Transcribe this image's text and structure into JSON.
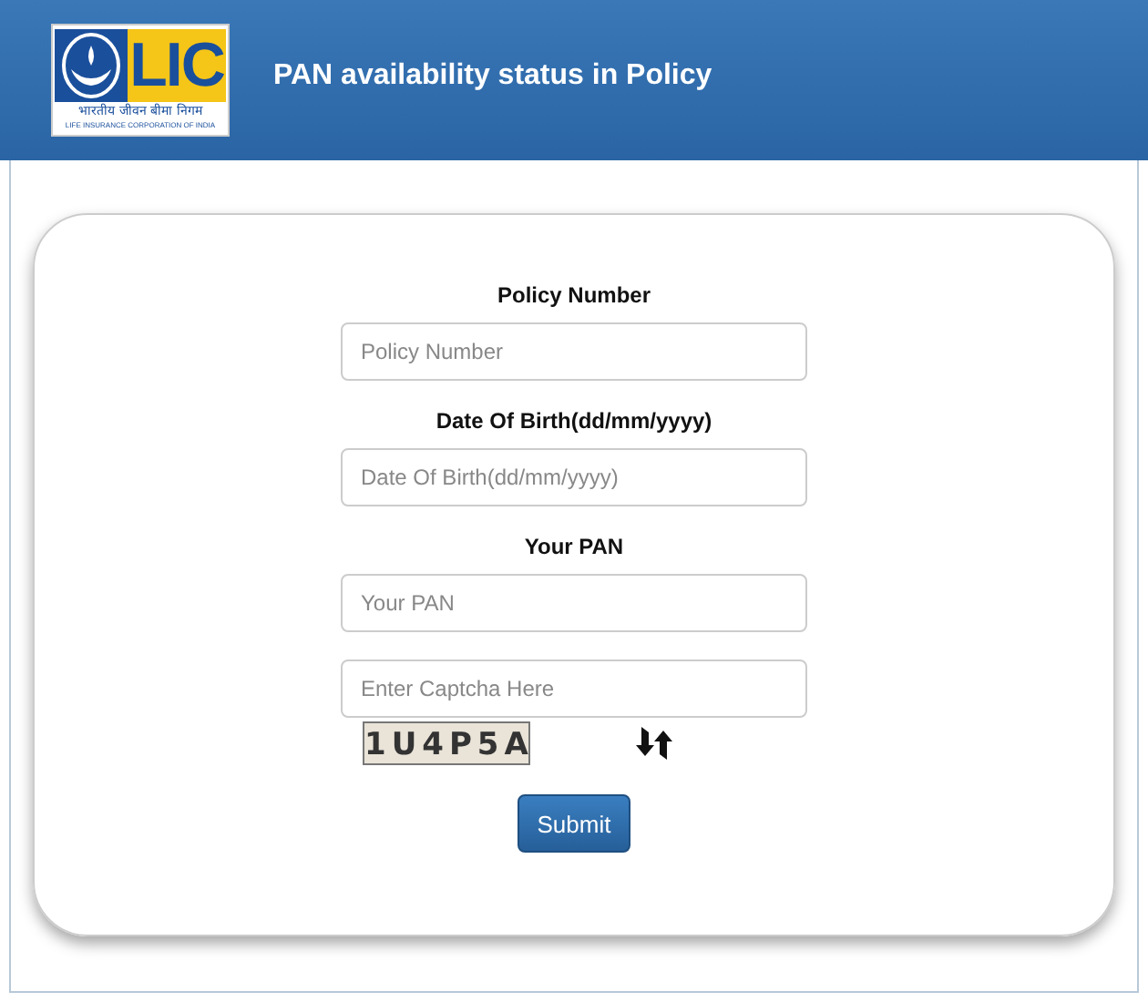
{
  "header": {
    "logo": {
      "mark": "LIC",
      "hindi": "भारतीय जीवन बीमा निगम",
      "english": "LIFE INSURANCE CORPORATION OF INDIA"
    },
    "title": "PAN availability status in Policy"
  },
  "form": {
    "fields": [
      {
        "label": "Policy Number",
        "placeholder": "Policy Number"
      },
      {
        "label": "Date Of Birth(dd/mm/yyyy)",
        "placeholder": "Date Of Birth(dd/mm/yyyy)"
      },
      {
        "label": "Your PAN",
        "placeholder": "Your PAN"
      },
      {
        "placeholder": "Enter Captcha Here"
      }
    ],
    "captcha": "1U4P5A",
    "submit": "Submit"
  }
}
